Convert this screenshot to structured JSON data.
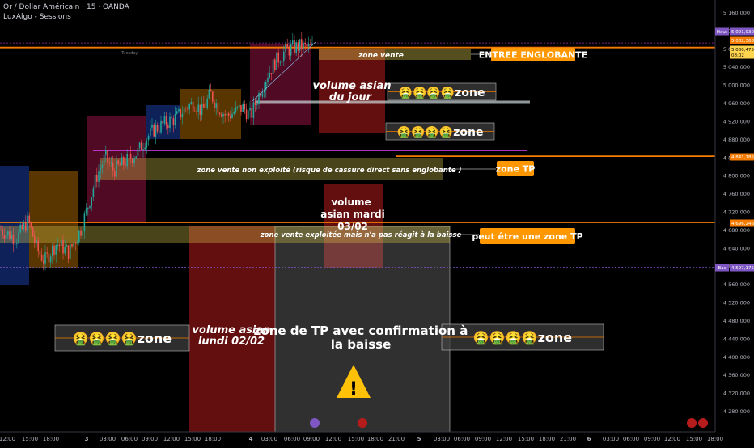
{
  "header": {
    "symbol_line": "Or / Dollar Américain · 15 · OANDA",
    "indicator_line": "LuxAlgo - Sessions"
  },
  "colors": {
    "background": "#000000",
    "candle_up": "#26a69a",
    "candle_down": "#ef5350",
    "orange_line": "#f57c00",
    "purple_line": "#e040fb",
    "yellow_zone": "#d4c44a",
    "asia_box": "#2962ff",
    "ny_box": "#ff9800",
    "london_box": "#e91e63",
    "dark_red": "#b71c1c",
    "grey_zone": "#9e9e9e",
    "callout_orange": "#ff9800"
  },
  "chart_data": {
    "type": "candlestick",
    "title": "",
    "y_axis": {
      "ticks": [
        "5 160,000",
        "5 120,000",
        "5 080,000",
        "5 040,000",
        "5 000,000",
        "4 960,000",
        "4 920,000",
        "4 880,000",
        "4 840,000",
        "4 800,000",
        "4 760,000",
        "4 720,000",
        "4 680,000",
        "4 640,000",
        "4 600,000",
        "4 560,000",
        "4 520,000",
        "4 480,000",
        "4 440,000",
        "4 400,000",
        "4 360,000",
        "4 320,000",
        "4 280,000"
      ],
      "range": [
        4240,
        5180
      ]
    },
    "x_axis": {
      "ticks": [
        "12:00",
        "15:00",
        "18:00",
        "3",
        "03:00",
        "06:00",
        "09:00",
        "12:00",
        "15:00",
        "18:00",
        "4",
        "03:00",
        "06:00",
        "09:00",
        "12:00",
        "15:00",
        "18:00",
        "21:00",
        "5",
        "03:00",
        "06:00",
        "09:00",
        "12:00",
        "15:00",
        "18:00",
        "21:00",
        "6",
        "03:00",
        "06:00",
        "09:00",
        "12:00",
        "15:00",
        "18:00"
      ]
    },
    "price_labels": [
      {
        "label": "Haut",
        "value": "5 091,930",
        "style": "purple"
      },
      {
        "label": "",
        "value": "5 082,368",
        "style": "orange"
      },
      {
        "label": "",
        "value": "5 080,475",
        "sub": "08:02",
        "style": "yellow"
      },
      {
        "label": "",
        "value": "4 841,785",
        "style": "orange"
      },
      {
        "label": "",
        "value": "4 696,246",
        "style": "orange"
      },
      {
        "label": "Bas",
        "value": "4 597,175",
        "style": "purple"
      }
    ],
    "session_labels": [
      "Tuesday"
    ],
    "levels": [
      {
        "name": "orange-top",
        "price": 5082,
        "color": "orange"
      },
      {
        "name": "orange-mid",
        "price": 4842,
        "color": "orange"
      },
      {
        "name": "orange-low",
        "price": 4696,
        "color": "orange"
      },
      {
        "name": "purple-level",
        "price": 4857,
        "color": "purple"
      },
      {
        "name": "grey-level",
        "price": 4965,
        "color": "grey"
      }
    ],
    "candles_summary": {
      "start_price": 4680,
      "low": 4597,
      "high": 5092,
      "last": 5080
    },
    "annotations": {
      "zone_vente": "zone vente",
      "entree": "ENTREE ENGLOBANTE",
      "volume_asian_jour": "volume asian du jour",
      "zone_emoji_1": "🤮🤮🤮🤮zone",
      "zone_emoji_2": "🤮🤮🤮🤮zone",
      "zone_vente_non_exploite": "zone vente non exploité (risque de cassure direct sans englobante )",
      "zone_tp": "zone TP",
      "volume_asian_mardi": "volume asian mardi 03/02",
      "zone_vente_exploitee": "zone vente exploitée mais n'a pas réagit à la baisse",
      "peut_etre_tp": "peut être une zone TP",
      "zone_emoji_left": "🤮🤮🤮🤮zone",
      "volume_asian_lundi": "volume asian lundi 02/02",
      "zone_tp_confirmation": "zone de TP avec confirmation à la baisse",
      "zone_emoji_right": "🤮🤮🤮🤮zone",
      "warning": "⚠️"
    }
  }
}
